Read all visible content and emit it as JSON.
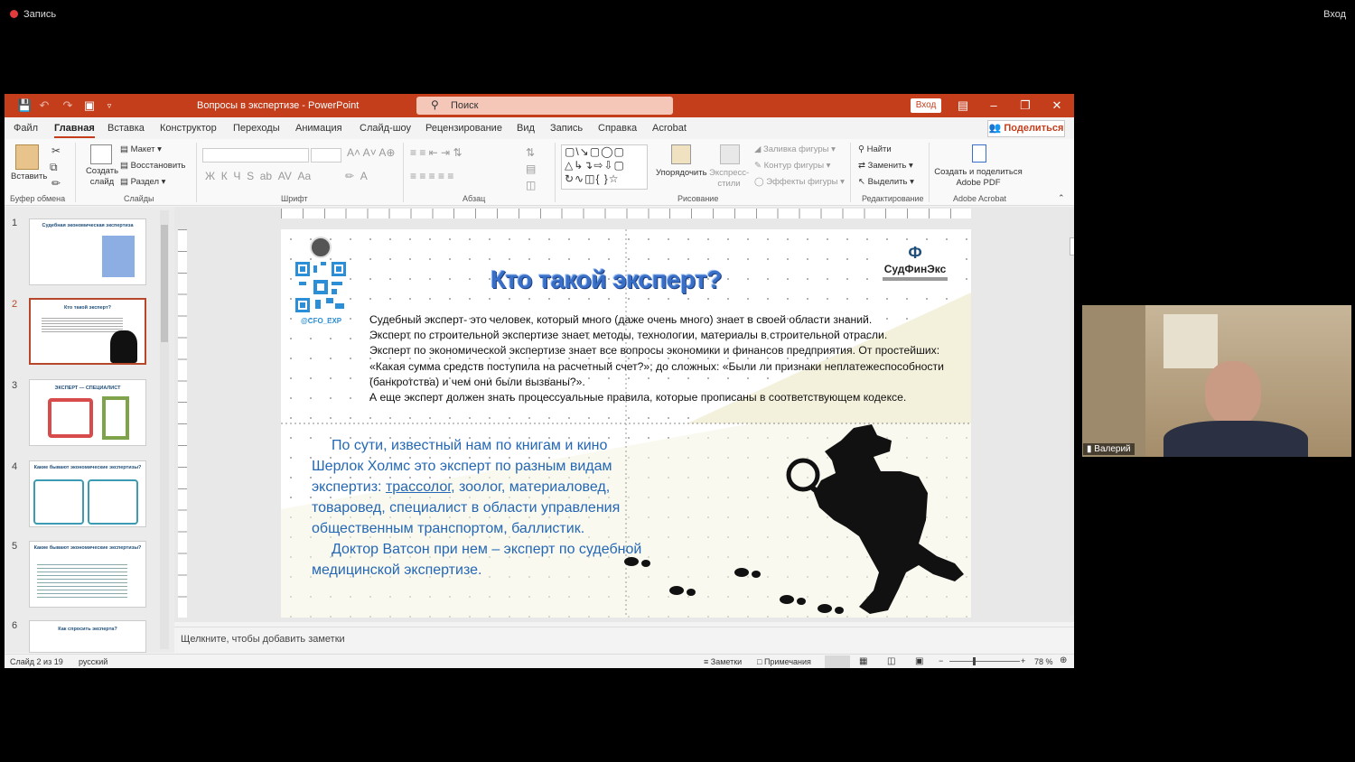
{
  "zoom": {
    "recording_label": "Запись",
    "enter_label": "Вход"
  },
  "titlebar": {
    "doc_title": "Вопросы в экспертизе - PowerPoint",
    "search_placeholder": "Поиск",
    "signin": "Вход"
  },
  "tabs": [
    "Файл",
    "Главная",
    "Вставка",
    "Конструктор",
    "Переходы",
    "Анимация",
    "Слайд-шоу",
    "Рецензирование",
    "Вид",
    "Запись",
    "Справка",
    "Acrobat"
  ],
  "share_label": "Поделиться",
  "ribbon": {
    "clipboard": {
      "paste": "Вставить",
      "label": "Буфер обмена"
    },
    "slides": {
      "new_slide": "Создать слайд",
      "layout": "Макет",
      "reset": "Восстановить",
      "section": "Раздел",
      "label": "Слайды"
    },
    "font": {
      "label": "Шрифт"
    },
    "paragraph": {
      "label": "Абзац"
    },
    "drawing": {
      "arrange": "Упорядочить",
      "quick_styles": "Экспресс-стили",
      "shape_fill": "Заливка фигуры",
      "shape_outline": "Контур фигуры",
      "shape_effects": "Эффекты фигуры",
      "label": "Рисование"
    },
    "editing": {
      "find": "Найти",
      "replace": "Заменить",
      "select": "Выделить",
      "label": "Редактирование"
    },
    "acrobat": {
      "create": "Создать и поделиться Adobe PDF",
      "label": "Adobe Acrobat"
    }
  },
  "thumbnails": [
    {
      "num": "1",
      "title": "Судебная экономическая экспертиза"
    },
    {
      "num": "2",
      "title": "Кто такой эксперт?"
    },
    {
      "num": "3",
      "title": "ЭКСПЕРТ — СПЕЦИАЛИСТ"
    },
    {
      "num": "4",
      "title": "Какие бывают экономические экспертизы?"
    },
    {
      "num": "5",
      "title": "Какие бывают экономические экспертизы?"
    },
    {
      "num": "6",
      "title": "Как спросить эксперта?"
    }
  ],
  "slide": {
    "title": "Кто такой эксперт?",
    "qr_label": "@CFO_EXP",
    "logo_name": "СудФинЭкс",
    "body": [
      "Судебный эксперт- это человек, который много (даже очень много) знает в своей области знаний.",
      "Эксперт по строительной экспертизе знает методы, технологии, материалы в строительной отрасли.",
      "Эксперт по экономической экспертизе знает все вопросы экономики и финансов предприятия. От простейших: «Какая сумма средств поступила на расчетный счет?»; до сложных: «Были ли признаки неплатежеспособности (банкротства) и чем они были вызваны?».",
      "А еще эксперт должен знать процессуальные правила, которые прописаны в соответствующем кодексе."
    ],
    "blue_1a": "По сути, известный нам по книгам и кино Шерлок Холмс это эксперт по разным видам экспертиз: ",
    "blue_1_link": "трассолог",
    "blue_1b": ", зоолог, материаловед, товаровед, специалист в области управления общественным транспортом, баллистик.",
    "blue_2": "Доктор Ватсон при нем – эксперт по судебной медицинской экспертизе."
  },
  "notes_placeholder": "Щелкните, чтобы добавить заметки",
  "status": {
    "slide_of": "Слайд 2 из 19",
    "language": "русский",
    "notes": "Заметки",
    "comments": "Примечания",
    "zoom": "78 %"
  },
  "webcam": {
    "name": "Валерий"
  },
  "colors": {
    "ppt_accent": "#c43e1c",
    "slide_title": "#3a6fc7",
    "slide_blue_text": "#2467b4"
  }
}
